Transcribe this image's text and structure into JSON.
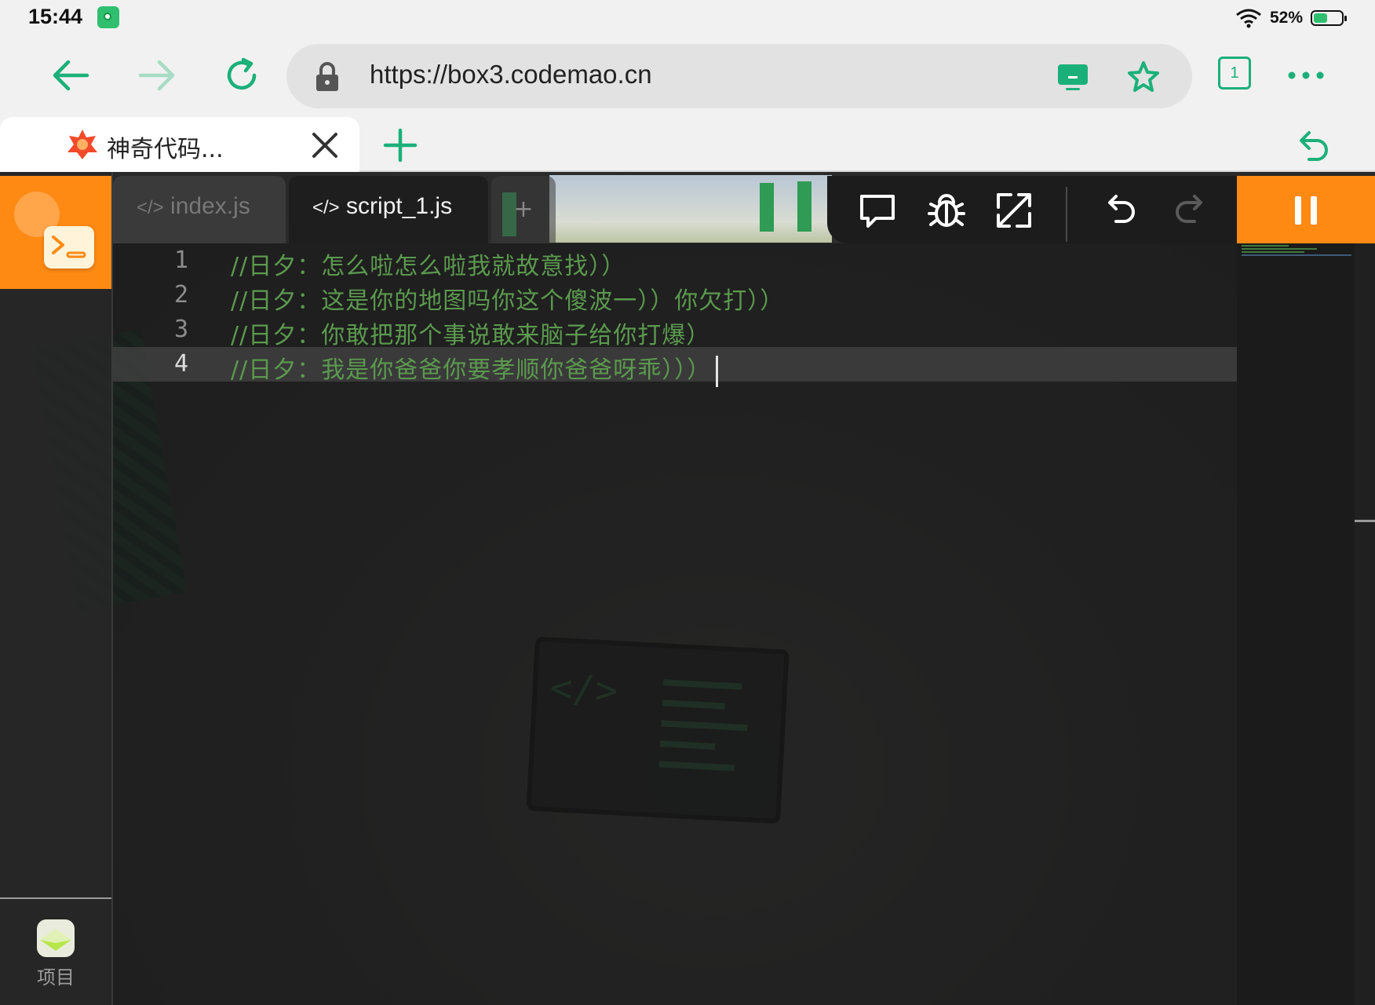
{
  "status": {
    "time": "15:44",
    "battery": "52%",
    "battery_level": 0.52
  },
  "browser": {
    "url": "https://box3.codemao.cn",
    "tab_count": "1",
    "tab_title": "神奇代码..."
  },
  "editor": {
    "tabs": [
      {
        "label": "index.js"
      },
      {
        "label": "script_1.js"
      }
    ],
    "add_tab": "+",
    "lines": [
      {
        "num": "1",
        "text": "//日夕：怎么啦怎么啦我就故意找））"
      },
      {
        "num": "2",
        "text": "//日夕：这是你的地图吗你这个傻波一））你欠打））"
      },
      {
        "num": "3",
        "text": "//日夕：你敢把那个事说敢来脑子给你打爆）"
      },
      {
        "num": "4",
        "text": "//日夕：我是你爸爸你要孝顺你爸爸呀乖）））"
      }
    ]
  },
  "sidebar": {
    "project_label": "项目"
  },
  "icons": {
    "back": "back-arrow-icon",
    "forward": "forward-arrow-icon",
    "reload": "reload-icon",
    "lock": "lock-icon",
    "cast": "desktop-icon",
    "bookmark": "star-icon",
    "menu": "more-icon",
    "close": "close-icon",
    "new_tab": "plus-icon",
    "undo": "undo-icon",
    "comment": "comment-icon",
    "debug": "bug-icon",
    "fullscreen": "expand-icon",
    "redo": "redo-icon",
    "pause": "pause-icon"
  },
  "colors": {
    "accent_green": "#1bb07a",
    "orange": "#fe8a13",
    "comment_green": "#5b9a4e"
  }
}
